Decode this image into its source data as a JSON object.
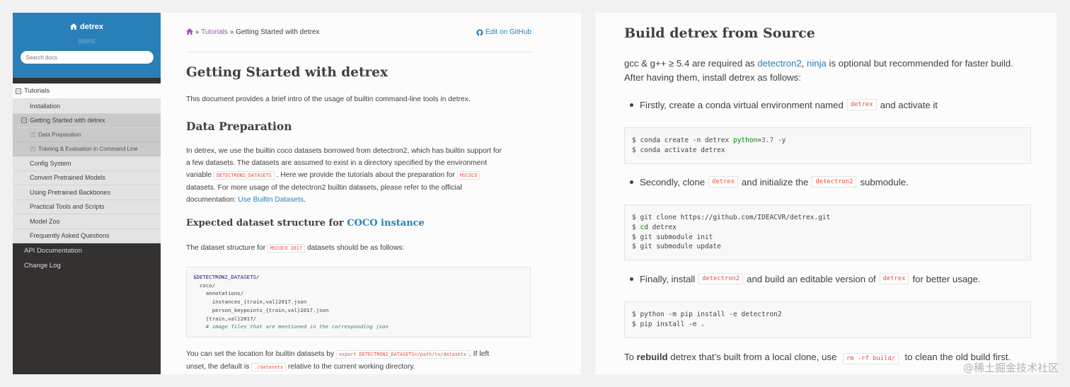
{
  "sidebar": {
    "title": "detrex",
    "version": "latest",
    "search_placeholder": "Search docs",
    "current_section": "Tutorials",
    "items_before": [
      "Installation"
    ],
    "current_page": "Getting Started with detrex",
    "subsections": [
      "Data Preparation",
      "Training & Evaluation in Command Line"
    ],
    "items_after": [
      "Config System",
      "Convert Pretrained Models",
      "Using Pretrained Backbones",
      "Practical Tools and Scripts",
      "Model Zoo",
      "Frequently Asked Questions"
    ],
    "top_items": [
      "API Documentation",
      "Change Log"
    ]
  },
  "breadcrumb": {
    "home_icon": "home-icon",
    "sep": "»",
    "tutorials": "Tutorials",
    "current": "Getting Started with detrex",
    "edit_label": "Edit on GitHub"
  },
  "left_doc": {
    "title": "Getting Started with detrex",
    "intro": "This document provides a brief intro of the usage of builtin command-line tools in detrex.",
    "data_prep_heading": "Data Preparation",
    "data_prep_p1": "In detrex, we use the builtin coco datasets borrowed from detectron2, which has builtin support for",
    "data_prep_p2": "a few datasets. The datasets are assumed to exist in a directory specified by the environment",
    "data_prep_p3a": "variable",
    "data_prep_code1": "DETECTRON2_DATASETS",
    "data_prep_p3b": ". Here we provide the tutorials about the preparation for",
    "data_prep_code2": "MSCOCO",
    "data_prep_p4": "datasets. For more usage of the detectron2 builtin datasets, please refer to the official",
    "data_prep_p5a": "documentation:",
    "data_prep_link": "Use Builtin Datasets",
    "data_prep_p5b": ".",
    "structure_heading": "Expected dataset structure for",
    "structure_link": "COCO instance",
    "structure_p_a": "The dataset structure for",
    "structure_code": "MSCOCO 2017",
    "structure_p_b": "datasets should be as follows:",
    "tree_var": "$DETECTRON2_DATASETS/",
    "tree_lines": [
      "  coco/",
      "    annotations/",
      "      instances_{train,val}2017.json",
      "      person_keypoints_{train,val}2017.json",
      "    {train,val}2017/"
    ],
    "tree_comment": "    # image files that are mentioned in the corresponding json",
    "loc_p1a": "You can set the location for builtin datasets by",
    "loc_code": "export DETECTRON2_DATASETS=/path/to/datasets",
    "loc_p1b": ". If left",
    "loc_p2a": "unset, the default is",
    "loc_code2": "./datasets",
    "loc_p2b": "relative to the current working directory."
  },
  "right_doc": {
    "heading": "Build detrex from Source",
    "req_a": "gcc & g++ ≥ 5.4 are required as",
    "req_link1": "detectron2",
    "req_comma": ",",
    "req_link2": "ninja",
    "req_b": "is optional but recommended for faster build.",
    "req_c": "After having them, install detrex as follows:",
    "step1_a": "Firstly, create a conda virtual environment named",
    "step1_code": "detrex",
    "step1_b": "and activate it",
    "cmd1_l1a": "$ conda create -n detrex ",
    "cmd1_l1kw": "python",
    "cmd1_l1b": "=",
    "cmd1_l1num": "3.7",
    "cmd1_l1c": " -y",
    "cmd1_l2": "$ conda activate detrex",
    "step2_a": "Secondly, clone",
    "step2_code1": "detrex",
    "step2_b": "and initialize the",
    "step2_code2": "detectron2",
    "step2_c": "submodule.",
    "cmd2_l1": "$ git clone https://github.com/IDEACVR/detrex.git",
    "cmd2_l2a": "$ ",
    "cmd2_l2kw": "cd",
    "cmd2_l2b": " detrex",
    "cmd2_l3": "$ git submodule init",
    "cmd2_l4": "$ git submodule update",
    "step3_a": "Finally, install",
    "step3_code1": "detectron2",
    "step3_b": "and build an editable version of",
    "step3_code2": "detrex",
    "step3_c": "for better usage.",
    "cmd3_l1": "$ python -m pip install -e detectron2",
    "cmd3_l2": "$ pip install -e .",
    "rebuild_a": "To",
    "rebuild_bold": "rebuild",
    "rebuild_b": "detrex that’s built from a local clone, use",
    "rebuild_code": "rm -rf build/",
    "rebuild_c": "to clean the old build first."
  },
  "watermark": "@稀土掘金技术社区",
  "colors": {
    "brand": "#2980b9",
    "sidebar_bg": "#343131",
    "code_red": "#e74c3c",
    "link_purple": "#9b59b6"
  }
}
